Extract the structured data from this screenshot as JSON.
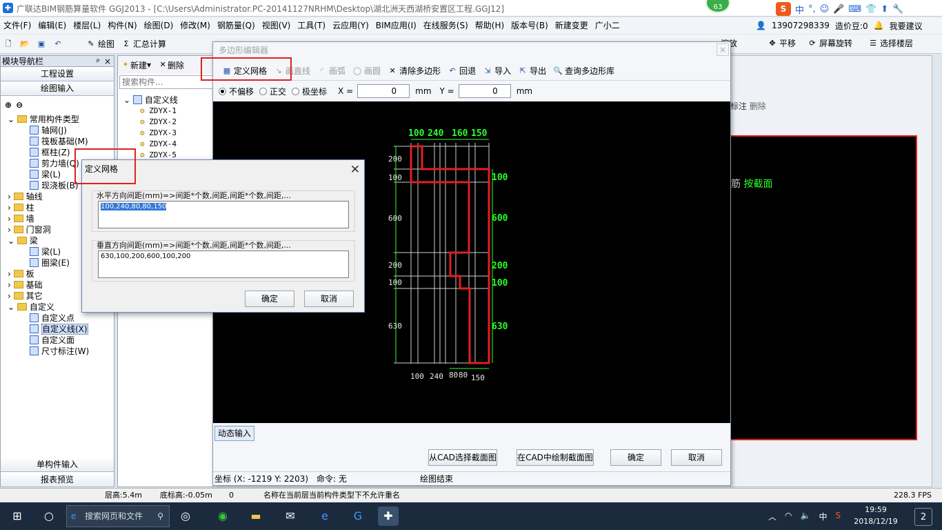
{
  "window": {
    "title": "广联达BIM钢筋算量软件 GGJ2013 - [C:\\Users\\Administrator.PC-20141127NRHM\\Desktop\\湖北洲天西湖桥安置区工程.GGJ12]",
    "badge": "63"
  },
  "ime": {
    "s": "S",
    "mode": "中",
    "items": [
      "°,",
      "☺",
      "🎤",
      "⌨",
      "👕",
      "⬆",
      "🔧"
    ]
  },
  "menu": [
    "文件(F)",
    "编辑(E)",
    "楼层(L)",
    "构件(N)",
    "绘图(D)",
    "修改(M)",
    "钢筋量(Q)",
    "视图(V)",
    "工具(T)",
    "云应用(Y)",
    "BIM应用(I)",
    "在线服务(S)",
    "帮助(H)",
    "版本号(B)",
    "新建变更",
    "广小二"
  ],
  "menu_right": {
    "phone": "13907298339",
    "bean": "造价豆:0",
    "suggest": "我要建议"
  },
  "toolbar": {
    "draw": "绘图",
    "sum": "汇总计算",
    "zoom": "缩放",
    "pan": "平移",
    "rotate": "屏幕旋转",
    "select_floor": "选择楼层"
  },
  "nav": {
    "header": "模块导航栏",
    "project_settings": "工程设置",
    "draw_input": "绘图输入",
    "single_input": "单构件输入",
    "report_preview": "报表预览",
    "tree": [
      {
        "label": "常用构件类型",
        "level": 0,
        "type": "folder",
        "open": true
      },
      {
        "label": "轴网(J)",
        "level": 1,
        "type": "item"
      },
      {
        "label": "筏板基础(M)",
        "level": 1,
        "type": "item"
      },
      {
        "label": "框柱(Z)",
        "level": 1,
        "type": "item"
      },
      {
        "label": "剪力墙(Q)",
        "level": 1,
        "type": "item"
      },
      {
        "label": "梁(L)",
        "level": 1,
        "type": "item"
      },
      {
        "label": "现浇板(B)",
        "level": 1,
        "type": "item"
      },
      {
        "label": "轴线",
        "level": 0,
        "type": "folder"
      },
      {
        "label": "柱",
        "level": 0,
        "type": "folder"
      },
      {
        "label": "墙",
        "level": 0,
        "type": "folder"
      },
      {
        "label": "门窗洞",
        "level": 0,
        "type": "folder"
      },
      {
        "label": "梁",
        "level": 0,
        "type": "folder",
        "open": true
      },
      {
        "label": "梁(L)",
        "level": 1,
        "type": "item"
      },
      {
        "label": "圈梁(E)",
        "level": 1,
        "type": "item"
      },
      {
        "label": "板",
        "level": 0,
        "type": "folder"
      },
      {
        "label": "基础",
        "level": 0,
        "type": "folder"
      },
      {
        "label": "其它",
        "level": 0,
        "type": "folder"
      },
      {
        "label": "自定义",
        "level": 0,
        "type": "folder",
        "open": true
      },
      {
        "label": "自定义点",
        "level": 1,
        "type": "item"
      },
      {
        "label": "自定义线(X)",
        "level": 1,
        "type": "item",
        "selected": true
      },
      {
        "label": "自定义面",
        "level": 1,
        "type": "item"
      },
      {
        "label": "尺寸标注(W)",
        "level": 1,
        "type": "item"
      }
    ]
  },
  "components": {
    "new": "新建",
    "delete": "删除",
    "search_placeholder": "搜索构件...",
    "root": "自定义线",
    "items": [
      "ZDYX-1",
      "ZDYX-2",
      "ZDYX-3",
      "ZDYX-4",
      "ZDYX-5"
    ]
  },
  "right": {
    "annot": "标注",
    "delete": "删除",
    "rebar": "筋",
    "by_section": "按截面"
  },
  "poly_editor": {
    "title": "多边形编辑器",
    "tools": {
      "define_grid": "定义网格",
      "line": "画直线",
      "arc": "画弧",
      "circle": "画圆",
      "clear": "清除多边形",
      "undo": "回退",
      "import": "导入",
      "export": "导出",
      "query": "查询多边形库"
    },
    "options": {
      "no_offset": "不偏移",
      "ortho": "正交",
      "polar": "极坐标",
      "x_label": "X =",
      "x_value": "0",
      "y_label": "Y =",
      "y_value": "0",
      "unit": "mm"
    },
    "dynamic_input": "动态输入",
    "buttons": {
      "from_cad": "从CAD选择截面图",
      "draw_cad": "在CAD中绘制截面图",
      "ok": "确定",
      "cancel": "取消"
    },
    "status": {
      "coords": "坐标 (X: -1219 Y: 2203)",
      "command": "命令: 无",
      "state": "绘图结束"
    },
    "drawing": {
      "top_dims": [
        "100",
        "240",
        "160",
        "150"
      ],
      "bottom_dims": [
        "100",
        "240",
        "80",
        "80",
        "150"
      ],
      "left_dims": [
        "200",
        "100",
        "600",
        "200",
        "100",
        "630"
      ],
      "right_dims": [
        "100",
        "600",
        "200",
        "100",
        "630"
      ]
    }
  },
  "grid_dialog": {
    "title": "定义网格",
    "h_label": "水平方向间距(mm)=>间距*个数,间距,间距*个数,间距,...",
    "h_value": "100,240,80,80,150",
    "v_label": "垂直方向间距(mm)=>间距*个数,间距,间距*个数,间距,...",
    "v_value": "630,100,200,600,100,200",
    "ok": "确定",
    "cancel": "取消"
  },
  "statusbar": {
    "floor_height": "层高:5.4m",
    "base_height": "底标高:-0.05m",
    "zero": "0",
    "message": "名称在当前层当前构件类型下不允许重名",
    "fps": "228.3 FPS"
  },
  "taskbar": {
    "search": "搜索网页和文件",
    "ime": "中",
    "time": "19:59",
    "date": "2018/12/19",
    "notif": "2"
  },
  "colors": {
    "highlight": "#e02020",
    "cad_green": "#2bff2b",
    "canvas": "#000000"
  }
}
